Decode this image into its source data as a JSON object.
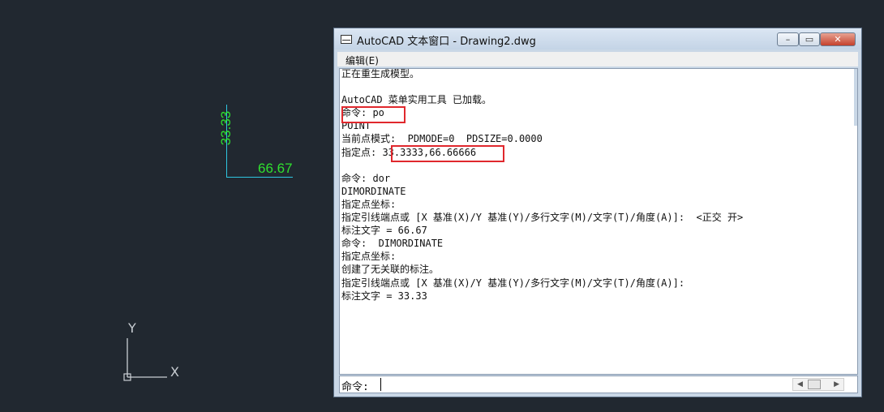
{
  "drawing": {
    "dim_horizontal_text": "66.67",
    "dim_vertical_text": "33.33",
    "ucs_y_label": "Y",
    "ucs_x_label": "X"
  },
  "window": {
    "title": "AutoCAD 文本窗口 - Drawing2.dwg",
    "min_label": "–",
    "max_label": "▭",
    "close_label": "✕",
    "menu_edit": "编辑(E)"
  },
  "log": [
    "正在重生成模型。",
    "",
    "AutoCAD 菜单实用工具 已加载。",
    "命令: po",
    "POINT",
    "当前点模式:  PDMODE=0  PDSIZE=0.0000",
    "指定点: 33.3333,66.66666",
    "",
    "命令: dor",
    "DIMORDINATE",
    "指定点坐标:",
    "指定引线端点或 [X 基准(X)/Y 基准(Y)/多行文字(M)/文字(T)/角度(A)]:  <正交 开>",
    "标注文字 = 66.67",
    "命令:  DIMORDINATE",
    "指定点坐标:",
    "创建了无关联的标注。",
    "指定引线端点或 [X 基准(X)/Y 基准(Y)/多行文字(M)/文字(T)/角度(A)]:",
    "标注文字 = 33.33"
  ],
  "command_prompt": "命令:",
  "colors": {
    "highlight": "#e0282d",
    "dimension_line": "#2ec6e0",
    "dimension_text": "#2fe02f",
    "background": "#212830"
  }
}
